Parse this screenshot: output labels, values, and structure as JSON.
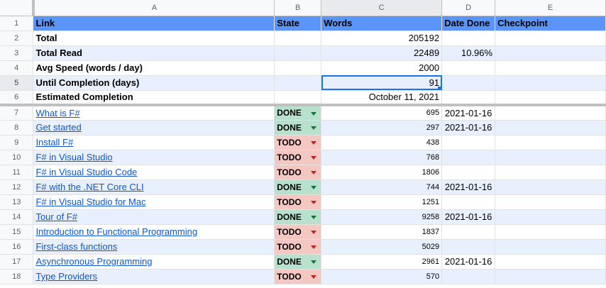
{
  "columns": [
    "A",
    "B",
    "C",
    "D",
    "E"
  ],
  "header": {
    "row": "1",
    "link": "Link",
    "state": "State",
    "words": "Words",
    "date_done": "Date Done",
    "checkpoint": "Checkpoint"
  },
  "summary": [
    {
      "row": "2",
      "label": "Total",
      "value": "205192",
      "extra": ""
    },
    {
      "row": "3",
      "label": "Total Read",
      "value": "22489",
      "extra": "10.96%"
    },
    {
      "row": "4",
      "label": "Avg Speed (words / day)",
      "value": "2000",
      "extra": ""
    },
    {
      "row": "5",
      "label": "Until Completion (days)",
      "value": "91",
      "extra": ""
    },
    {
      "row": "6",
      "label": "Estimated Completion",
      "value": "October 11, 2021",
      "extra": ""
    }
  ],
  "items": [
    {
      "row": "7",
      "link": "What is F#",
      "state": "DONE",
      "words": "695",
      "date": "2021-01-16"
    },
    {
      "row": "8",
      "link": "Get started",
      "state": "DONE",
      "words": "297",
      "date": "2021-01-16"
    },
    {
      "row": "9",
      "link": "Install F#",
      "state": "TODO",
      "words": "438",
      "date": ""
    },
    {
      "row": "10",
      "link": "F# in Visual Studio",
      "state": "TODO",
      "words": "768",
      "date": ""
    },
    {
      "row": "11",
      "link": "F# in Visual Studio Code",
      "state": "TODO",
      "words": "1806",
      "date": ""
    },
    {
      "row": "12",
      "link": "F# with the .NET Core CLI",
      "state": "DONE",
      "words": "744",
      "date": "2021-01-16"
    },
    {
      "row": "13",
      "link": "F# in Visual Studio for Mac",
      "state": "TODO",
      "words": "1251",
      "date": ""
    },
    {
      "row": "14",
      "link": "Tour of F#",
      "state": "DONE",
      "words": "9258",
      "date": "2021-01-16"
    },
    {
      "row": "15",
      "link": "Introduction to Functional Programming",
      "state": "TODO",
      "words": "1837",
      "date": ""
    },
    {
      "row": "16",
      "link": "First-class functions",
      "state": "TODO",
      "words": "5029",
      "date": ""
    },
    {
      "row": "17",
      "link": "Asynchronous Programming",
      "state": "DONE",
      "words": "2961",
      "date": "2021-01-16"
    },
    {
      "row": "18",
      "link": "Type Providers",
      "state": "TODO",
      "words": "570",
      "date": ""
    }
  ],
  "colors": {
    "header_fill": "#5b95f9",
    "band_fill": "#e8f0fe",
    "done_fill": "#b7e1cd",
    "todo_fill": "#f4c7c3",
    "link": "#1155cc",
    "selection": "#1a73e8"
  }
}
